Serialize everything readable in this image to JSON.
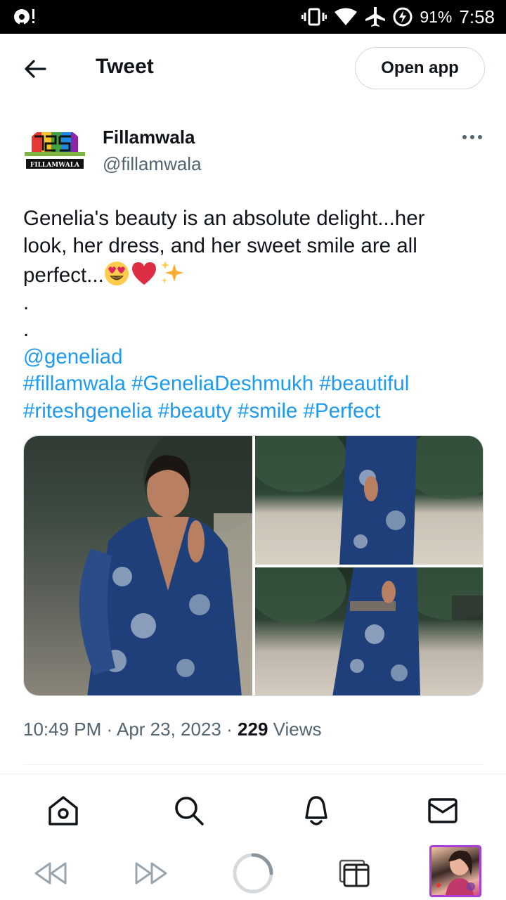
{
  "status_bar": {
    "battery_percent": "91%",
    "time": "7:58"
  },
  "header": {
    "title": "Tweet",
    "open_app_label": "Open app"
  },
  "author": {
    "name": "Fillamwala",
    "handle": "@fillamwala",
    "avatar_logo_text": "FILLAMWALA"
  },
  "tweet": {
    "text_lines": [
      "Genelia's beauty is an absolute delight...her",
      "look, her dress, and her sweet smile are all",
      "perfect..."
    ],
    "emojis": [
      "smiling-face-with-heart-eyes",
      "red-heart",
      "sparkles"
    ],
    "dot_lines": [
      ".",
      "."
    ],
    "mention": "@geneliad",
    "hashtag_lines": [
      "#fillamwala #GeneliaDeshmukh #beautiful",
      "#riteshgenelia #beauty #smile #Perfect"
    ]
  },
  "media": {
    "photos": [
      "photo-1",
      "photo-2",
      "photo-3"
    ]
  },
  "meta": {
    "time": "10:49 PM",
    "separator": "·",
    "date": "Apr 23, 2023",
    "views_count": "229",
    "views_label": "Views"
  },
  "bottom_nav": {
    "items": [
      "home-icon",
      "search-icon",
      "notifications-icon",
      "messages-icon"
    ]
  },
  "browser_toolbar": {
    "items": [
      "rewind-icon",
      "fast-forward-icon",
      "loading-spinner",
      "tabs-icon",
      "profile-thumbnail"
    ]
  },
  "colors": {
    "link": "#1d9bf0",
    "text": "#0f1419",
    "secondary_text": "#536471",
    "border": "#cfd9de",
    "profile_border": "#a93fd6"
  }
}
